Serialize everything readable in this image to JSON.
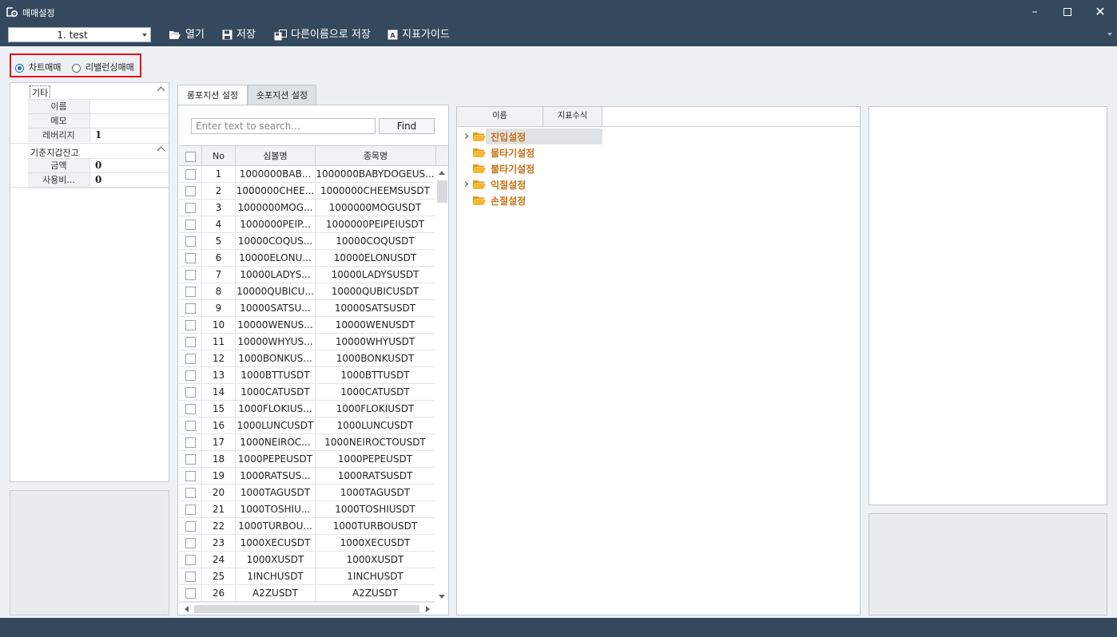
{
  "window": {
    "title": "매매설정",
    "icon": "gear-chart-icon"
  },
  "toolbar": {
    "combo_value": "1. test",
    "open_label": "열기",
    "save_label": "저장",
    "saveas_label": "다른이름으로 저장",
    "guide_label": "지표가이드"
  },
  "mode": {
    "chart_label": "차트매매",
    "rebalance_label": "리밸런싱매매",
    "selected": "차트매매"
  },
  "properties": {
    "cat1": "기타",
    "name_key": "이름",
    "name_val": "",
    "memo_key": "메모",
    "memo_val": "",
    "leverage_key": "레버리지",
    "leverage_val": "1",
    "cat2": "기준지갑잔고",
    "amount_key": "금액",
    "amount_val": "0",
    "usage_key": "사용비...",
    "usage_val": "0"
  },
  "tabs": {
    "long": "롱포지션 설정",
    "short": "숏포지션 설정"
  },
  "search": {
    "placeholder": "Enter text to search...",
    "find_label": "Find"
  },
  "grid": {
    "headers": {
      "no": "No",
      "symbol": "심볼명",
      "name": "종목명"
    },
    "rows": [
      {
        "no": "1",
        "symbol": "1000000BAB...",
        "name": "1000000BABYDOGEUS..."
      },
      {
        "no": "2",
        "symbol": "1000000CHEE...",
        "name": "1000000CHEEMSUSDT"
      },
      {
        "no": "3",
        "symbol": "1000000MOG...",
        "name": "1000000MOGUSDT"
      },
      {
        "no": "4",
        "symbol": "1000000PEIP...",
        "name": "1000000PEIPEIUSDT"
      },
      {
        "no": "5",
        "symbol": "10000COQUS...",
        "name": "10000COQUSDT"
      },
      {
        "no": "6",
        "symbol": "10000ELONU...",
        "name": "10000ELONUSDT"
      },
      {
        "no": "7",
        "symbol": "10000LADYS...",
        "name": "10000LADYSUSDT"
      },
      {
        "no": "8",
        "symbol": "10000QUBICU...",
        "name": "10000QUBICUSDT"
      },
      {
        "no": "9",
        "symbol": "10000SATSU...",
        "name": "10000SATSUSDT"
      },
      {
        "no": "10",
        "symbol": "10000WENUS...",
        "name": "10000WENUSDT"
      },
      {
        "no": "11",
        "symbol": "10000WHYUS...",
        "name": "10000WHYUSDT"
      },
      {
        "no": "12",
        "symbol": "1000BONKUS...",
        "name": "1000BONKUSDT"
      },
      {
        "no": "13",
        "symbol": "1000BTTUSDT",
        "name": "1000BTTUSDT"
      },
      {
        "no": "14",
        "symbol": "1000CATUSDT",
        "name": "1000CATUSDT"
      },
      {
        "no": "15",
        "symbol": "1000FLOKIUS...",
        "name": "1000FLOKIUSDT"
      },
      {
        "no": "16",
        "symbol": "1000LUNCUSDT",
        "name": "1000LUNCUSDT"
      },
      {
        "no": "17",
        "symbol": "1000NEIROC...",
        "name": "1000NEIROCTOUSDT"
      },
      {
        "no": "18",
        "symbol": "1000PEPEUSDT",
        "name": "1000PEPEUSDT"
      },
      {
        "no": "19",
        "symbol": "1000RATSUS...",
        "name": "1000RATSUSDT"
      },
      {
        "no": "20",
        "symbol": "1000TAGUSDT",
        "name": "1000TAGUSDT"
      },
      {
        "no": "21",
        "symbol": "1000TOSHIU...",
        "name": "1000TOSHIUSDT"
      },
      {
        "no": "22",
        "symbol": "1000TURBOU...",
        "name": "1000TURBOUSDT"
      },
      {
        "no": "23",
        "symbol": "1000XECUSDT",
        "name": "1000XECUSDT"
      },
      {
        "no": "24",
        "symbol": "1000XUSDT",
        "name": "1000XUSDT"
      },
      {
        "no": "25",
        "symbol": "1INCHUSDT",
        "name": "1INCHUSDT"
      },
      {
        "no": "26",
        "symbol": "A2ZUSDT",
        "name": "A2ZUSDT"
      }
    ]
  },
  "tree": {
    "headers": {
      "name": "이름",
      "formula": "지표수식"
    },
    "nodes": [
      {
        "label": "진입설정",
        "expandable": true,
        "selected": true
      },
      {
        "label": "물타기설정",
        "expandable": false,
        "selected": false
      },
      {
        "label": "불타기설정",
        "expandable": false,
        "selected": false
      },
      {
        "label": "익절설정",
        "expandable": true,
        "selected": false
      },
      {
        "label": "손절설정",
        "expandable": false,
        "selected": false
      }
    ]
  },
  "colors": {
    "titlebar": "#34495e",
    "accent": "#1b6ec2",
    "highlight_border": "#e0121b",
    "folder": "#f2a31b",
    "tree_text": "#c86f12"
  }
}
